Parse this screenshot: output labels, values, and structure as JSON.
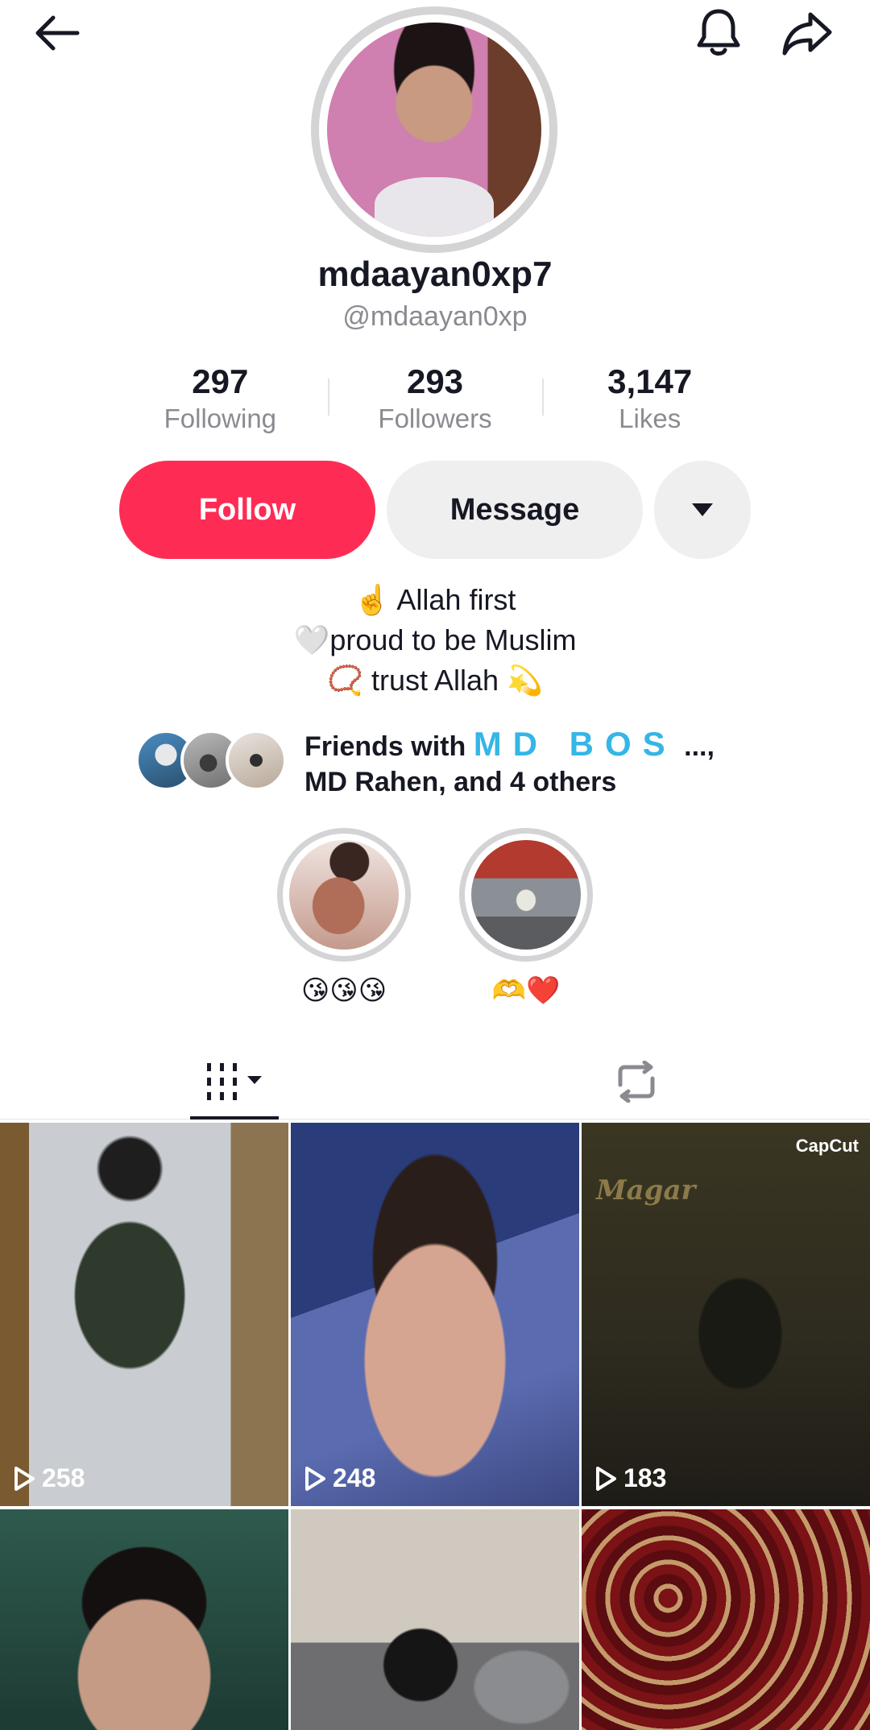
{
  "profile": {
    "display_name": "mdaayan0xp7",
    "username": "@mdaayan0xp"
  },
  "stats": [
    {
      "value": "297",
      "label": "Following"
    },
    {
      "value": "293",
      "label": "Followers"
    },
    {
      "value": "3,147",
      "label": "Likes"
    }
  ],
  "actions": {
    "follow_label": "Follow",
    "message_label": "Message"
  },
  "bio": {
    "line1": "☝️ Allah first",
    "line2": "🤍proud to be Muslim",
    "line3": "📿 trust Allah 💫"
  },
  "friends": {
    "prefix": "Friends with ",
    "highlight_name": "MD BOS",
    "suffix": " ...,",
    "line2": "MD Rahen, and 4 others"
  },
  "highlights": [
    {
      "label": "😘😘😘"
    },
    {
      "label": "🫶❤️"
    }
  ],
  "videos": [
    {
      "views": "258"
    },
    {
      "views": "248"
    },
    {
      "views": "183",
      "overlay_brand": "CapCut",
      "overlay_text": "Magar"
    },
    {
      "views": ""
    },
    {
      "views": ""
    },
    {
      "views": ""
    }
  ],
  "icons": {
    "back": "arrow-left-icon",
    "bell": "bell-icon",
    "share": "share-arrow-icon",
    "dropdown": "caret-down-icon",
    "videos_tab": "grid-videos-icon",
    "reposts_tab": "repost-icon",
    "play": "play-outline-icon"
  },
  "colors": {
    "accent": "#fe2c55",
    "highlight_name": "#35b6e6",
    "secondary_text": "#8a8b91"
  }
}
